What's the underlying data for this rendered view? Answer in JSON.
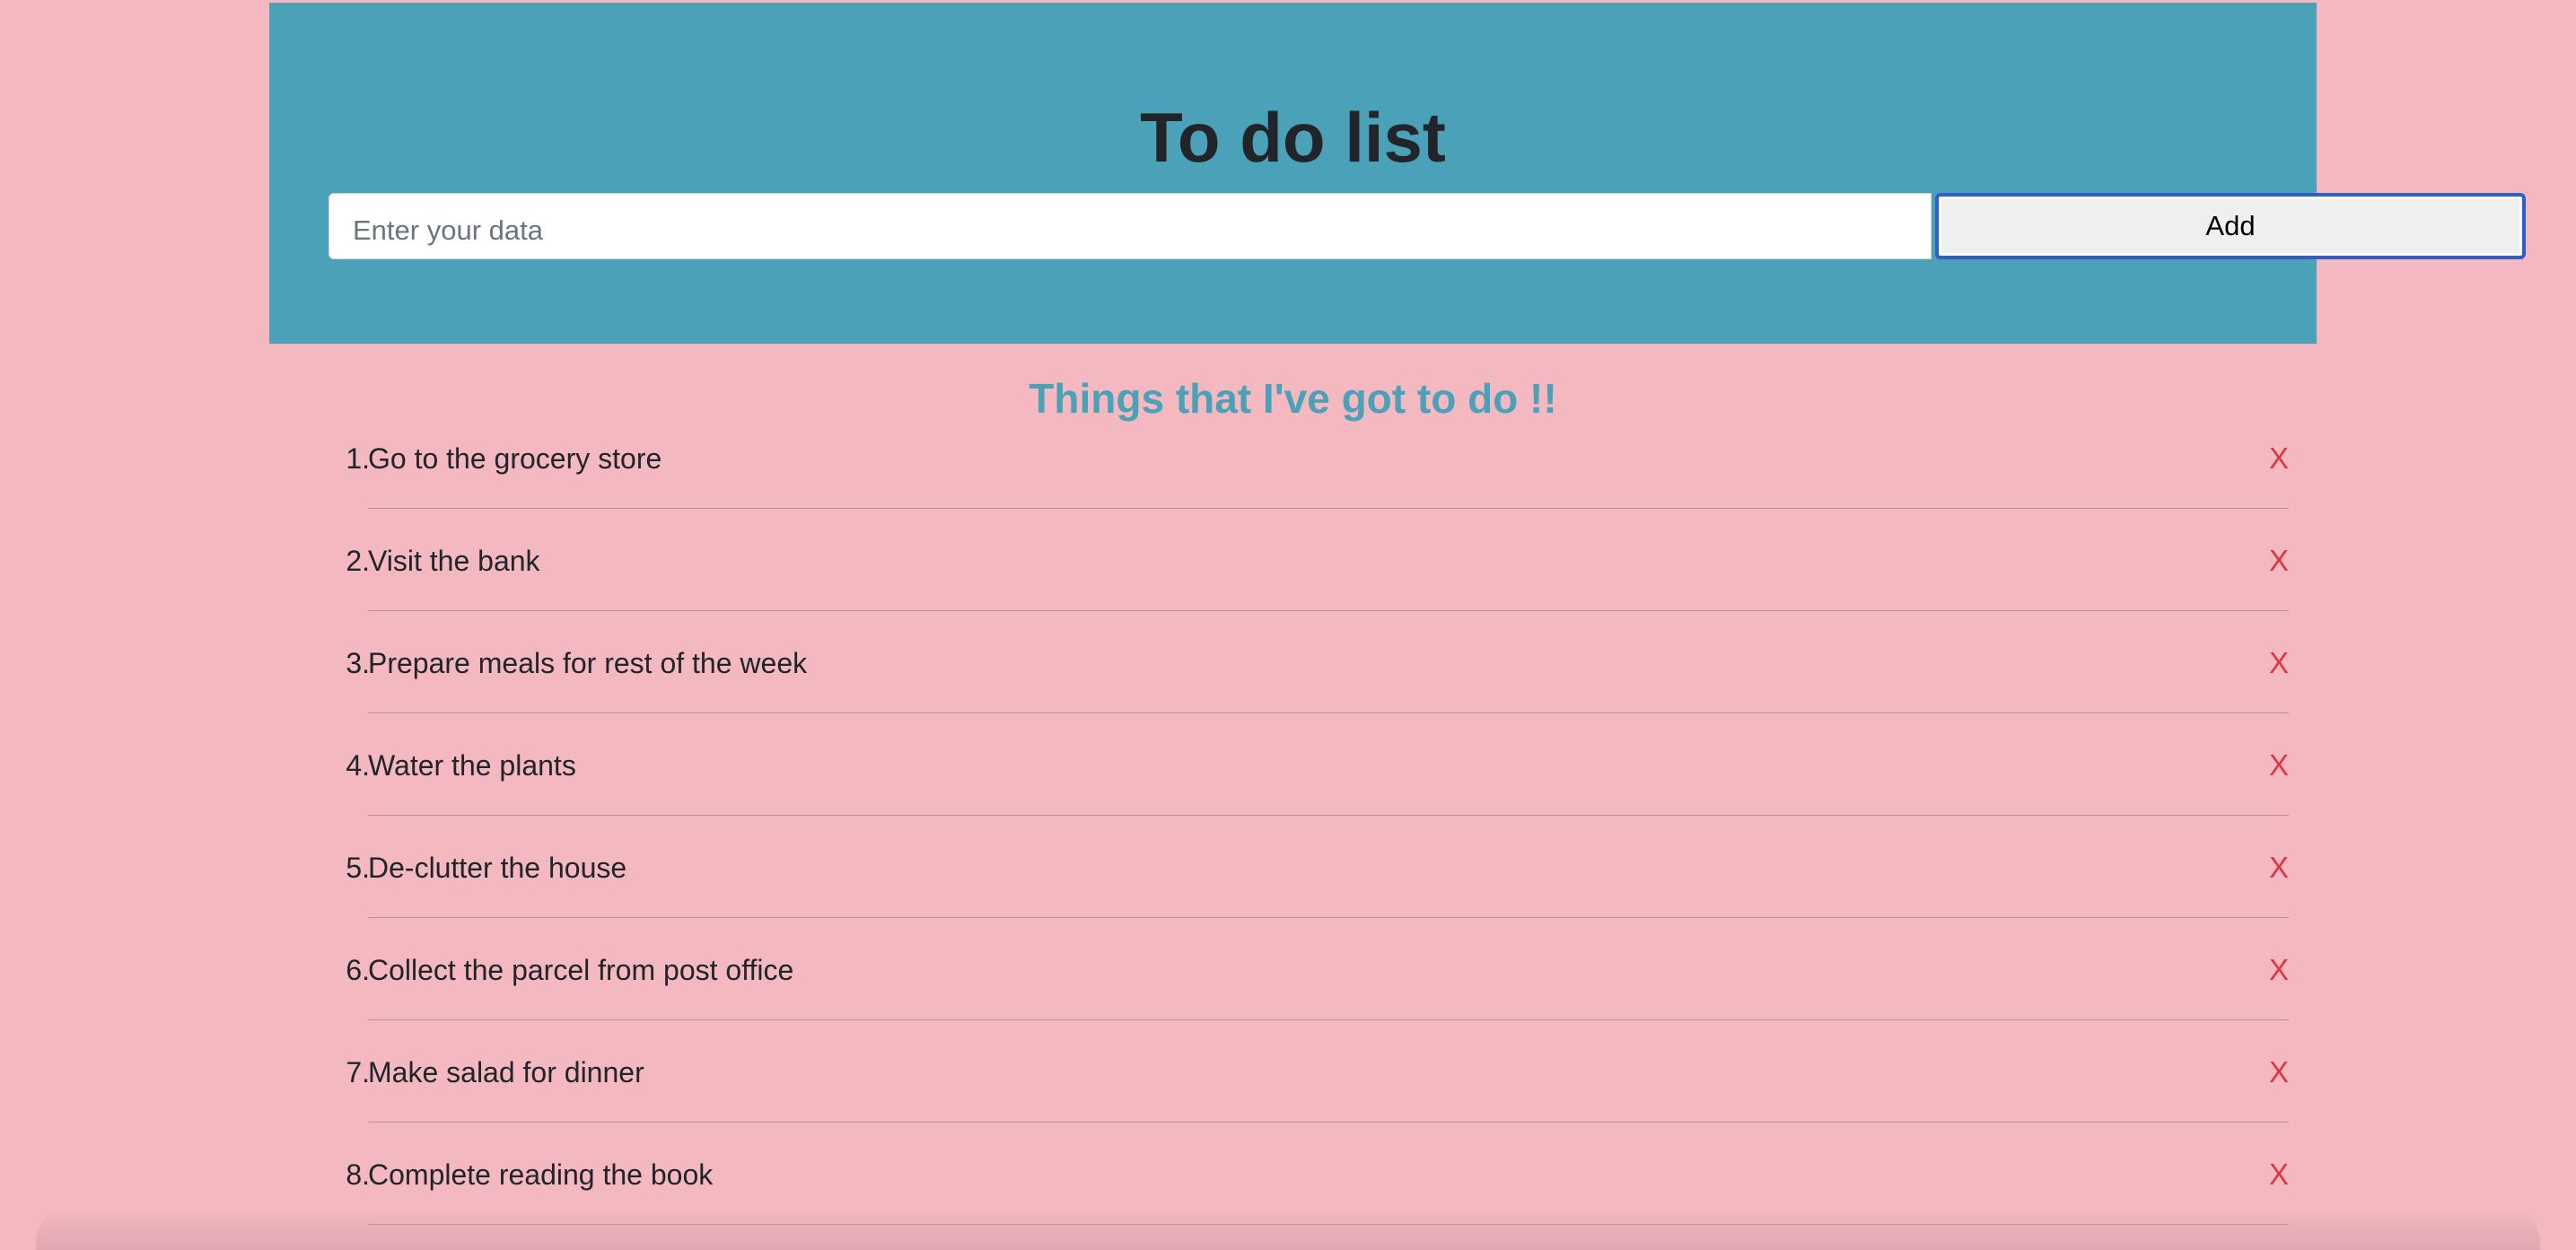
{
  "header": {
    "title": "To do list",
    "input_placeholder": "Enter your data",
    "input_value": "",
    "add_label": "Add"
  },
  "list": {
    "heading": "Things that I've got to do !!",
    "delete_label": "X",
    "items": [
      {
        "number": "1.",
        "text": "Go to the grocery store"
      },
      {
        "number": "2.",
        "text": "Visit the bank"
      },
      {
        "number": "3.",
        "text": "Prepare meals for rest of the week"
      },
      {
        "number": "4.",
        "text": "Water the plants"
      },
      {
        "number": "5.",
        "text": "De-clutter the house"
      },
      {
        "number": "6.",
        "text": "Collect the parcel from post office"
      },
      {
        "number": "7.",
        "text": "Make salad for dinner"
      },
      {
        "number": "8.",
        "text": "Complete reading the book"
      }
    ]
  },
  "colors": {
    "page_background": "#f4b8c0",
    "header_background": "#4ba1b7",
    "heading_accent": "#4ba1b7",
    "delete_red": "#dc3545"
  }
}
